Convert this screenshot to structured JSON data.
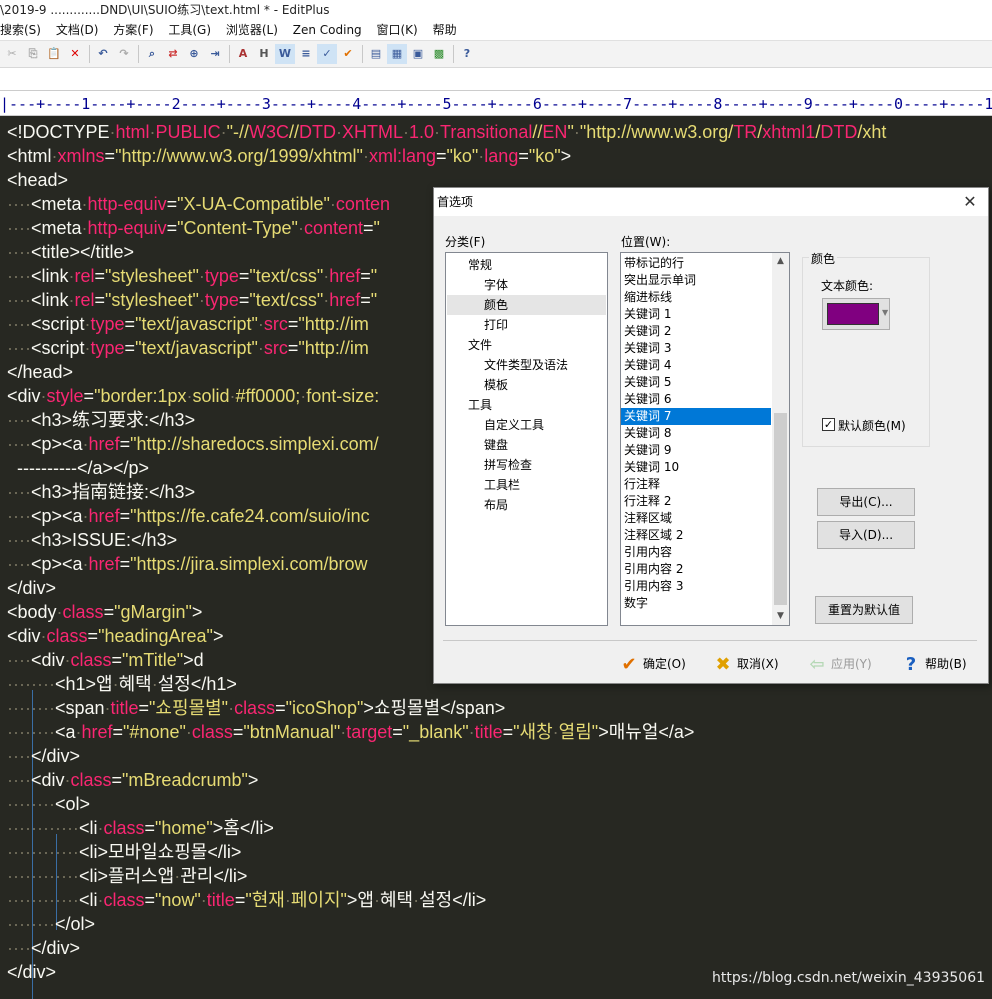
{
  "window": {
    "title": "\\2019-9 .............DND\\UI\\SUIO练习\\text.html * - EditPlus"
  },
  "menu": [
    "搜索(S)",
    "文档(D)",
    "方案(F)",
    "工具(G)",
    "浏览器(L)",
    "Zen Coding",
    "窗口(K)",
    "帮助"
  ],
  "ruler": "|---+----1----+----2----+----3----+----4----+----5----+----6----+----7----+----8----+----9----+----0----+----1",
  "dialog": {
    "title": "首选项",
    "close": "✕",
    "category_label": "分类(F)",
    "categories": [
      {
        "label": "常规",
        "level": 0
      },
      {
        "label": "字体",
        "level": 1
      },
      {
        "label": "颜色",
        "level": 1,
        "selected": true
      },
      {
        "label": "打印",
        "level": 1
      },
      {
        "label": "文件",
        "level": 0
      },
      {
        "label": "文件类型及语法",
        "level": 1
      },
      {
        "label": "模板",
        "level": 1
      },
      {
        "label": "工具",
        "level": 0
      },
      {
        "label": "自定义工具",
        "level": 1
      },
      {
        "label": "键盘",
        "level": 1
      },
      {
        "label": "拼写检查",
        "level": 1
      },
      {
        "label": "工具栏",
        "level": 1
      },
      {
        "label": "布局",
        "level": 1
      }
    ],
    "position_label": "位置(W):",
    "positions": [
      "带标记的行",
      "突出显示单词",
      "缩进标线",
      "关键词 1",
      "关键词 2",
      "关键词 3",
      "关键词 4",
      "关键词 5",
      "关键词 6",
      "关键词 7",
      "关键词 8",
      "关键词 9",
      "关键词 10",
      "行注释",
      "行注释 2",
      "注释区域",
      "注释区域 2",
      "引用内容",
      "引用内容 2",
      "引用内容 3",
      "数字"
    ],
    "selected_position": "关键词 7",
    "color_group": "颜色",
    "text_color_label": "文本颜色:",
    "text_color": "#800080",
    "default_color_label": "默认颜色(M)",
    "default_color_checked": "✓",
    "export_btn": "导出(C)...",
    "import_btn": "导入(D)...",
    "reset_btn": "重置为默认值",
    "ok": "确定(O)",
    "cancel": "取消(X)",
    "apply": "应用(Y)",
    "help": "帮助(B)"
  },
  "code_lines": [
    [
      [
        "t",
        "<!DOCTYPE"
      ],
      [
        "d",
        "·"
      ],
      [
        "a",
        "html"
      ],
      [
        "d",
        "·"
      ],
      [
        "a",
        "PUBLIC"
      ],
      [
        "d",
        "·"
      ],
      [
        "s",
        "\"-//"
      ],
      [
        "a",
        "W3C"
      ],
      [
        "s",
        "//"
      ],
      [
        "a",
        "DTD"
      ],
      [
        "d",
        "·"
      ],
      [
        "a",
        "XHTML"
      ],
      [
        "d",
        "·"
      ],
      [
        "a",
        "1.0"
      ],
      [
        "d",
        "·"
      ],
      [
        "a",
        "Transitional"
      ],
      [
        "s",
        "//"
      ],
      [
        "a",
        "EN"
      ],
      [
        "s",
        "\""
      ],
      [
        "d",
        "·"
      ],
      [
        "s",
        "\"http://www.w3.org/"
      ],
      [
        "a",
        "TR"
      ],
      [
        "s",
        "/"
      ],
      [
        "a",
        "xhtml1"
      ],
      [
        "s",
        "/"
      ],
      [
        "a",
        "DTD"
      ],
      [
        "s",
        "/xht"
      ]
    ],
    [
      [
        "t",
        "<html"
      ],
      [
        "d",
        "·"
      ],
      [
        "a",
        "xmlns"
      ],
      [
        "t",
        "="
      ],
      [
        "s",
        "\"http://www.w3.org/1999/xhtml\""
      ],
      [
        "d",
        "·"
      ],
      [
        "a",
        "xml:lang"
      ],
      [
        "t",
        "="
      ],
      [
        "s",
        "\"ko\""
      ],
      [
        "d",
        "·"
      ],
      [
        "a",
        "lang"
      ],
      [
        "t",
        "="
      ],
      [
        "s",
        "\"ko\""
      ],
      [
        "t",
        ">"
      ]
    ],
    [
      [
        "t",
        "<head>"
      ]
    ],
    [
      [
        "d",
        "····"
      ],
      [
        "t",
        "<meta"
      ],
      [
        "d",
        "·"
      ],
      [
        "a",
        "http-equiv"
      ],
      [
        "t",
        "="
      ],
      [
        "s",
        "\"X-UA-Compatible\""
      ],
      [
        "d",
        "·"
      ],
      [
        "a",
        "conten"
      ]
    ],
    [
      [
        "d",
        "····"
      ],
      [
        "t",
        "<meta"
      ],
      [
        "d",
        "·"
      ],
      [
        "a",
        "http-equiv"
      ],
      [
        "t",
        "="
      ],
      [
        "s",
        "\"Content-Type\""
      ],
      [
        "d",
        "·"
      ],
      [
        "a",
        "content"
      ],
      [
        "t",
        "="
      ],
      [
        "s",
        "\""
      ]
    ],
    [
      [
        "d",
        "····"
      ],
      [
        "t",
        "<title></title>"
      ]
    ],
    [
      [
        "d",
        "····"
      ],
      [
        "t",
        "<link"
      ],
      [
        "d",
        "·"
      ],
      [
        "a",
        "rel"
      ],
      [
        "t",
        "="
      ],
      [
        "s",
        "\"stylesheet\""
      ],
      [
        "d",
        "·"
      ],
      [
        "a",
        "type"
      ],
      [
        "t",
        "="
      ],
      [
        "s",
        "\"text/css\""
      ],
      [
        "d",
        "·"
      ],
      [
        "a",
        "href"
      ],
      [
        "t",
        "="
      ],
      [
        "s",
        "\""
      ]
    ],
    [
      [
        "d",
        "····"
      ],
      [
        "t",
        "<link"
      ],
      [
        "d",
        "·"
      ],
      [
        "a",
        "rel"
      ],
      [
        "t",
        "="
      ],
      [
        "s",
        "\"stylesheet\""
      ],
      [
        "d",
        "·"
      ],
      [
        "a",
        "type"
      ],
      [
        "t",
        "="
      ],
      [
        "s",
        "\"text/css\""
      ],
      [
        "d",
        "·"
      ],
      [
        "a",
        "href"
      ],
      [
        "t",
        "="
      ],
      [
        "s",
        "\""
      ]
    ],
    [
      [
        "d",
        "····"
      ],
      [
        "t",
        "<script"
      ],
      [
        "d",
        "·"
      ],
      [
        "a",
        "type"
      ],
      [
        "t",
        "="
      ],
      [
        "s",
        "\"text/javascript\""
      ],
      [
        "d",
        "·"
      ],
      [
        "a",
        "src"
      ],
      [
        "t",
        "="
      ],
      [
        "s",
        "\"http://im"
      ]
    ],
    [
      [
        "d",
        "····"
      ],
      [
        "t",
        "<script"
      ],
      [
        "d",
        "·"
      ],
      [
        "a",
        "type"
      ],
      [
        "t",
        "="
      ],
      [
        "s",
        "\"text/javascript\""
      ],
      [
        "d",
        "·"
      ],
      [
        "a",
        "src"
      ],
      [
        "t",
        "="
      ],
      [
        "s",
        "\"http://im"
      ]
    ],
    [
      [
        "t",
        "</head>"
      ]
    ],
    [
      [
        "t",
        "<div"
      ],
      [
        "d",
        "·"
      ],
      [
        "a",
        "style"
      ],
      [
        "t",
        "="
      ],
      [
        "s",
        "\"border:1px"
      ],
      [
        "d",
        "·"
      ],
      [
        "s",
        "solid"
      ],
      [
        "d",
        "·"
      ],
      [
        "s",
        "#ff0000;"
      ],
      [
        "d",
        "·"
      ],
      [
        "s",
        "font-size:"
      ]
    ],
    [
      [
        "d",
        "····"
      ],
      [
        "t",
        "<h3>练习要求:</h3>"
      ]
    ],
    [
      [
        "d",
        "····"
      ],
      [
        "t",
        "<p><a"
      ],
      [
        "d",
        "·"
      ],
      [
        "a",
        "href"
      ],
      [
        "t",
        "="
      ],
      [
        "s",
        "\"http://sharedocs.simplexi.com/"
      ]
    ],
    [
      [
        "t",
        "  ----------</a></p>"
      ]
    ],
    [
      [
        "d",
        "····"
      ],
      [
        "t",
        "<h3>指南链接:</h3>"
      ]
    ],
    [
      [
        "d",
        "····"
      ],
      [
        "t",
        "<p><a"
      ],
      [
        "d",
        "·"
      ],
      [
        "a",
        "href"
      ],
      [
        "t",
        "="
      ],
      [
        "s",
        "\"https://fe.cafe24.com/suio/inc"
      ]
    ],
    [
      [
        "d",
        "····"
      ],
      [
        "t",
        "<h3>ISSUE:</h3>"
      ]
    ],
    [
      [
        "d",
        "····"
      ],
      [
        "t",
        "<p><a"
      ],
      [
        "d",
        "·"
      ],
      [
        "a",
        "href"
      ],
      [
        "t",
        "="
      ],
      [
        "s",
        "\"https://jira.simplexi.com/brow"
      ]
    ],
    [
      [
        "t",
        "</div>"
      ]
    ],
    [
      [
        "t",
        "<body"
      ],
      [
        "d",
        "·"
      ],
      [
        "a",
        "class"
      ],
      [
        "t",
        "="
      ],
      [
        "s",
        "\"gMargin\""
      ],
      [
        "t",
        ">"
      ]
    ],
    [
      [
        "t",
        "<div"
      ],
      [
        "d",
        "·"
      ],
      [
        "a",
        "class"
      ],
      [
        "t",
        "="
      ],
      [
        "s",
        "\"headingArea\""
      ],
      [
        "t",
        ">"
      ]
    ],
    [
      [
        "d",
        "····"
      ],
      [
        "t",
        "<div"
      ],
      [
        "d",
        "·"
      ],
      [
        "a",
        "class"
      ],
      [
        "t",
        "="
      ],
      [
        "s",
        "\"mTitle\""
      ],
      [
        "t",
        ">d"
      ]
    ],
    [
      [
        "d",
        "········"
      ],
      [
        "t",
        "<h1>앱"
      ],
      [
        "d",
        "·"
      ],
      [
        "t",
        "혜택"
      ],
      [
        "d",
        "·"
      ],
      [
        "t",
        "설정</h1>"
      ]
    ],
    [
      [
        "d",
        "········"
      ],
      [
        "t",
        "<span"
      ],
      [
        "d",
        "·"
      ],
      [
        "a",
        "title"
      ],
      [
        "t",
        "="
      ],
      [
        "s",
        "\"쇼핑몰별\""
      ],
      [
        "d",
        "·"
      ],
      [
        "a",
        "class"
      ],
      [
        "t",
        "="
      ],
      [
        "s",
        "\"icoShop\""
      ],
      [
        "t",
        ">쇼핑몰별</span>"
      ]
    ],
    [
      [
        "d",
        "········"
      ],
      [
        "t",
        "<a"
      ],
      [
        "d",
        "·"
      ],
      [
        "a",
        "href"
      ],
      [
        "t",
        "="
      ],
      [
        "s",
        "\"#none\""
      ],
      [
        "d",
        "·"
      ],
      [
        "a",
        "class"
      ],
      [
        "t",
        "="
      ],
      [
        "s",
        "\"btnManual\""
      ],
      [
        "d",
        "·"
      ],
      [
        "a",
        "target"
      ],
      [
        "t",
        "="
      ],
      [
        "s",
        "\"_blank\""
      ],
      [
        "d",
        "·"
      ],
      [
        "a",
        "title"
      ],
      [
        "t",
        "="
      ],
      [
        "s",
        "\"새창"
      ],
      [
        "d",
        "·"
      ],
      [
        "s",
        "열림\""
      ],
      [
        "t",
        ">매뉴얼</a>"
      ]
    ],
    [
      [
        "d",
        "····"
      ],
      [
        "t",
        "</div>"
      ]
    ],
    [
      [
        "d",
        "····"
      ],
      [
        "t",
        "<div"
      ],
      [
        "d",
        "·"
      ],
      [
        "a",
        "class"
      ],
      [
        "t",
        "="
      ],
      [
        "s",
        "\"mBreadcrumb\""
      ],
      [
        "t",
        ">"
      ]
    ],
    [
      [
        "d",
        "········"
      ],
      [
        "t",
        "<ol>"
      ]
    ],
    [
      [
        "d",
        "············"
      ],
      [
        "t",
        "<li"
      ],
      [
        "d",
        "·"
      ],
      [
        "a",
        "class"
      ],
      [
        "t",
        "="
      ],
      [
        "s",
        "\"home\""
      ],
      [
        "t",
        ">홈</li>"
      ]
    ],
    [
      [
        "d",
        "············"
      ],
      [
        "t",
        "<li>모바일쇼핑몰</li>"
      ]
    ],
    [
      [
        "d",
        "············"
      ],
      [
        "t",
        "<li>플러스앱"
      ],
      [
        "d",
        "·"
      ],
      [
        "t",
        "관리</li>"
      ]
    ],
    [
      [
        "d",
        "············"
      ],
      [
        "t",
        "<li"
      ],
      [
        "d",
        "·"
      ],
      [
        "a",
        "class"
      ],
      [
        "t",
        "="
      ],
      [
        "s",
        "\"now\""
      ],
      [
        "d",
        "·"
      ],
      [
        "a",
        "title"
      ],
      [
        "t",
        "="
      ],
      [
        "s",
        "\"현재"
      ],
      [
        "d",
        "·"
      ],
      [
        "s",
        "페이지\""
      ],
      [
        "t",
        ">앱"
      ],
      [
        "d",
        "·"
      ],
      [
        "t",
        "혜택"
      ],
      [
        "d",
        "·"
      ],
      [
        "t",
        "설정</li>"
      ]
    ],
    [
      [
        "d",
        "········"
      ],
      [
        "t",
        "</ol>"
      ]
    ],
    [
      [
        "d",
        "····"
      ],
      [
        "t",
        "</div>"
      ]
    ],
    [
      [
        "t",
        "</div>"
      ]
    ]
  ],
  "watermark": "https://blog.csdn.net/weixin_43935061"
}
